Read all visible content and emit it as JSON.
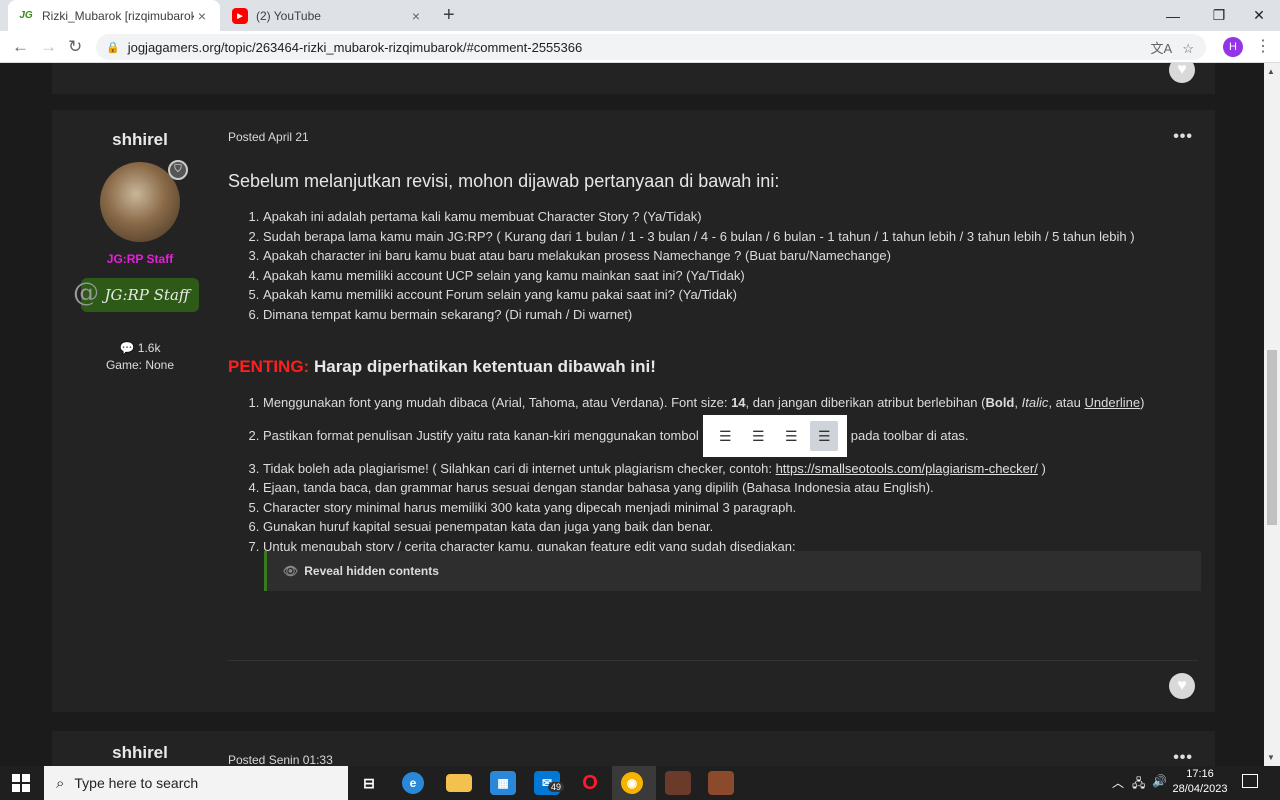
{
  "browser": {
    "tabs": [
      {
        "favicon": "JG",
        "title": "Rizki_Mubarok [rizqimubarok] - ",
        "close": "×"
      },
      {
        "favicon": "▶",
        "title": "(2) YouTube",
        "close": "×"
      }
    ],
    "new_tab": "+",
    "window_controls": {
      "minimize": "—",
      "restore": "❐",
      "close": "✕"
    },
    "nav": {
      "back": "←",
      "forward": "→",
      "reload": "↻"
    },
    "url": "jogjagamers.org/topic/263464-rizki_mubarok-rizqimubarok/#comment-2555366",
    "profile_initial": "H",
    "menu": "⋮"
  },
  "post": {
    "author": "shhirel",
    "role": "JG:RP Staff",
    "staff_badge": "JG:RP Staff",
    "post_count": "1.6k",
    "game": "Game: None",
    "posted": "Posted April 21",
    "options": "•••",
    "intro": "Sebelum melanjutkan revisi, mohon dijawab pertanyaan di bawah ini:",
    "questions": [
      "Apakah ini adalah pertama kali kamu membuat Character Story ? (Ya/Tidak)",
      "Sudah berapa lama kamu main JG:RP? ( Kurang dari 1 bulan / 1 - 3 bulan / 4 - 6 bulan / 6 bulan - 1 tahun / 1 tahun lebih / 3 tahun lebih / 5 tahun lebih )",
      "Apakah character ini baru kamu buat atau baru melakukan prosess Namechange ? (Buat baru/Namechange)",
      "Apakah kamu memiliki account UCP selain yang kamu mainkan saat ini? (Ya/Tidak)",
      "Apakah kamu memiliki account Forum selain yang kamu pakai saat ini? (Ya/Tidak)",
      "Dimana tempat kamu bermain sekarang? (Di rumah / Di warnet)"
    ],
    "penting_label": "PENTING:",
    "penting_text": " Harap diperhatikan ketentuan dibawah ini!",
    "rules": {
      "r1_a": "Menggunakan font yang mudah dibaca (Arial, Tahoma, atau Verdana). Font size: ",
      "r1_size": "14",
      "r1_b": ", dan jangan diberikan atribut berlebihan (",
      "r1_bold": "Bold",
      "r1_c": ", ",
      "r1_italic": "Italic",
      "r1_d": ", atau ",
      "r1_underline": "Underline",
      "r1_e": ")",
      "r2_a": "Pastikan format penulisan Justify yaitu rata kanan-kiri menggunakan tombol",
      "r2_b": "pada toolbar di atas.",
      "r3_a": "Tidak boleh ada plagiarisme! ( Silahkan cari di internet untuk plagiarism checker, contoh: ",
      "r3_link": "https://smallseotools.com/plagiarism-checker/",
      "r3_b": " )",
      "r4": "Ejaan, tanda baca, dan grammar harus sesuai dengan standar bahasa yang dipilih (Bahasa Indonesia atau English).",
      "r5": "Character story minimal harus memiliki 300 kata yang dipecah menjadi minimal 3 paragraph.",
      "r6": "Gunakan huruf kapital sesuai penempatan kata dan juga yang baik dan benar.",
      "r7": "Untuk mengubah story / cerita character kamu, gunakan feature edit yang sudah disediakan:"
    },
    "reveal": "Reveal hidden contents",
    "like_icon": "heart-icon"
  },
  "next_post": {
    "author": "shhirel",
    "posted": "Posted Senin 01:33",
    "options": "•••"
  },
  "taskbar": {
    "search_placeholder": "Type here to search",
    "mail_count": "49",
    "time": "17:16",
    "date": "28/04/2023"
  }
}
